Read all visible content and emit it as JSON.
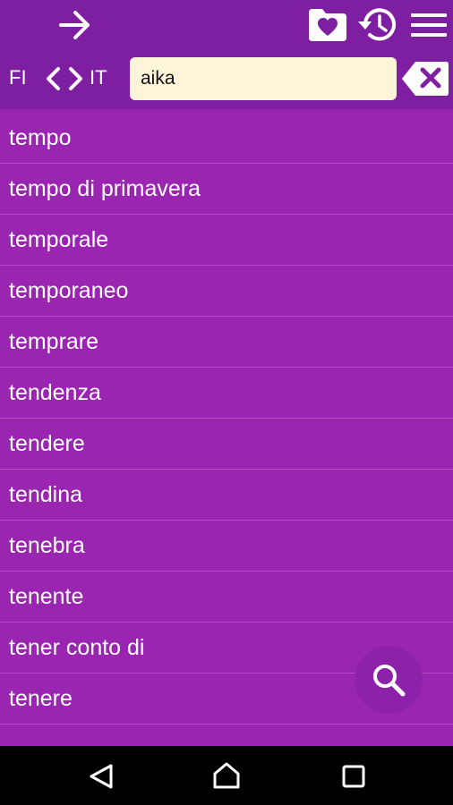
{
  "toolbar": {
    "forward_icon": "arrow-right-icon",
    "favorites_icon": "heart-folder-icon",
    "history_icon": "history-clock-icon",
    "menu_icon": "hamburger-menu-icon"
  },
  "languages": {
    "from": "FI",
    "to": "IT",
    "swap_icon": "chevron-left-right-icon"
  },
  "search": {
    "value": "aika",
    "clear_icon": "backspace-x-icon"
  },
  "words": [
    "tempo",
    "tempo di primavera",
    "temporale",
    "temporaneo",
    "temprare",
    "tendenza",
    "tendere",
    "tendina",
    "tenebra",
    "tenente",
    "tener conto di",
    "tenere"
  ],
  "fab": {
    "icon": "search-icon"
  },
  "navbar": {
    "back_icon": "back-triangle-icon",
    "home_icon": "home-icon",
    "recent_icon": "recent-apps-icon"
  },
  "colors": {
    "toolbar": "#7e1fa1",
    "list_background": "#9a25b0",
    "search_field": "#fdf5d9",
    "divider": "#b24dc4"
  }
}
